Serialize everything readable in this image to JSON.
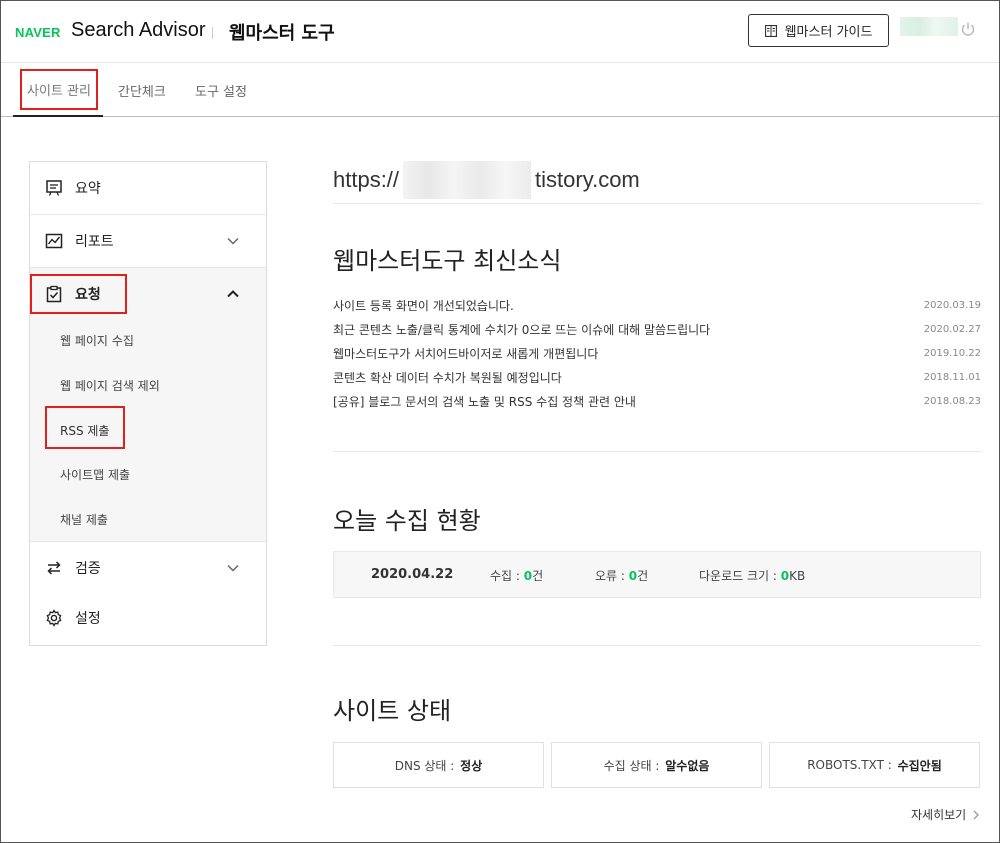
{
  "header": {
    "logo": "NAVER",
    "product": "Search Advisor",
    "tool_title": "웹마스터 도구",
    "guide_button": "웹마스터 가이드"
  },
  "tabs": [
    {
      "label": "사이트 관리",
      "active": true
    },
    {
      "label": "간단체크",
      "active": false
    },
    {
      "label": "도구 설정",
      "active": false
    }
  ],
  "sidebar": {
    "summary": "요약",
    "report": "리포트",
    "request": "요청",
    "request_sub": [
      "웹 페이지 수집",
      "웹 페이지 검색 제외",
      "RSS 제출",
      "사이트맵 제출",
      "채널 제출"
    ],
    "verify": "검증",
    "settings": "설정"
  },
  "site": {
    "url_prefix": "https://",
    "url_suffix": "tistory.com"
  },
  "news": {
    "title": "웹마스터도구 최신소식",
    "items": [
      {
        "title": "사이트 등록 화면이 개선되었습니다.",
        "date": "2020.03.19"
      },
      {
        "title": "최근 콘텐츠 노출/클릭 통계에 수치가 0으로 뜨는 이슈에 대해 말씀드립니다",
        "date": "2020.02.27"
      },
      {
        "title": "웹마스터도구가 서치어드바이저로 새롭게 개편됩니다",
        "date": "2019.10.22"
      },
      {
        "title": "콘텐츠 확산 데이터 수치가 복원될 예정입니다",
        "date": "2018.11.01"
      },
      {
        "title": "[공유] 블로그 문서의 검색 노출 및 RSS 수집 정책 관련 안내",
        "date": "2018.08.23"
      }
    ]
  },
  "today": {
    "title": "오늘 수집 현황",
    "date": "2020.04.22",
    "collect_label": "수집 : ",
    "collect_value": "0",
    "collect_unit": "건",
    "error_label": "오류 : ",
    "error_value": "0",
    "error_unit": "건",
    "download_label": "다운로드 크기 : ",
    "download_value": "0",
    "download_unit": "KB"
  },
  "status": {
    "title": "사이트 상태",
    "dns_label": "DNS 상태 :",
    "dns_value": "정상",
    "collect_label": "수집 상태 :",
    "collect_value": "알수없음",
    "robots_label": "ROBOTS.TXT :",
    "robots_value": "수집안됨",
    "more": "자세히보기"
  },
  "colors": {
    "brand_green": "#03c75a",
    "highlight_red": "#e0201a"
  }
}
